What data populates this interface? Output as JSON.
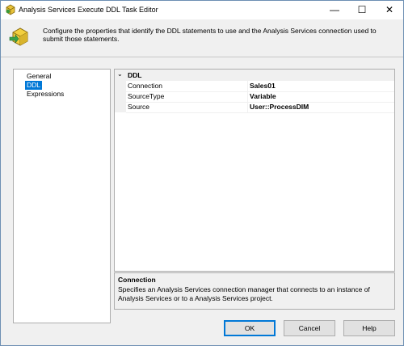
{
  "window": {
    "title": "Analysis Services Execute DDL Task Editor",
    "minimize": "—",
    "maximize": "☐",
    "close": "✕"
  },
  "header": {
    "description": "Configure the properties that identify the DDL statements to use and the Analysis Services connection used to submit those statements."
  },
  "nav": {
    "items": [
      {
        "label": "General"
      },
      {
        "label": "DDL"
      },
      {
        "label": "Expressions"
      }
    ],
    "selected": "DDL"
  },
  "grid": {
    "category": "DDL",
    "chevron": "⌄",
    "properties": [
      {
        "name": "Connection",
        "value": "Sales01"
      },
      {
        "name": "SourceType",
        "value": "Variable"
      },
      {
        "name": "Source",
        "value": "User::ProcessDIM"
      }
    ]
  },
  "description": {
    "title": "Connection",
    "text": "Specifies an Analysis Services connection manager that connects to an instance of Analysis Services or to a Analysis Services project."
  },
  "buttons": {
    "ok": "OK",
    "cancel": "Cancel",
    "help": "Help"
  },
  "colors": {
    "selection": "#0078d7",
    "border": "#adadad",
    "background": "#f0f0f0"
  }
}
